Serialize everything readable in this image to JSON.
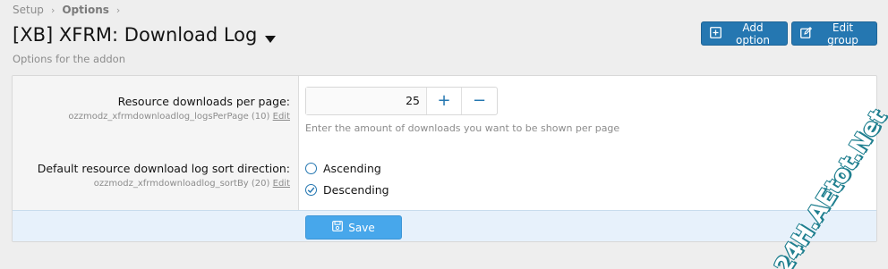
{
  "breadcrumb": [
    {
      "label": "Setup"
    },
    {
      "label": "Options"
    }
  ],
  "header": {
    "title": "[XB] XFRM: Download Log",
    "subtitle": "Options for the addon",
    "add_option_label": "Add option",
    "edit_group_label": "Edit group"
  },
  "options": {
    "per_page": {
      "label": "Resource downloads per page:",
      "meta": "ozzmodz_xfrmdownloadlog_logsPerPage (10)",
      "edit_label": "Edit",
      "value": "25",
      "plus": "+",
      "minus": "−",
      "hint": "Enter the amount of downloads you want to be shown per page"
    },
    "sort": {
      "label": "Default resource download log sort direction:",
      "meta": "ozzmodz_xfrmdownloadlog_sortBy (20)",
      "edit_label": "Edit",
      "choices": [
        {
          "label": "Ascending",
          "selected": false
        },
        {
          "label": "Descending",
          "selected": true
        }
      ]
    }
  },
  "footer": {
    "save_label": "Save"
  },
  "watermark": {
    "text": "24H.AEtot.Net"
  },
  "colors": {
    "primary": "#2577b1",
    "save": "#47a7eb",
    "background": "#eeeeee"
  }
}
